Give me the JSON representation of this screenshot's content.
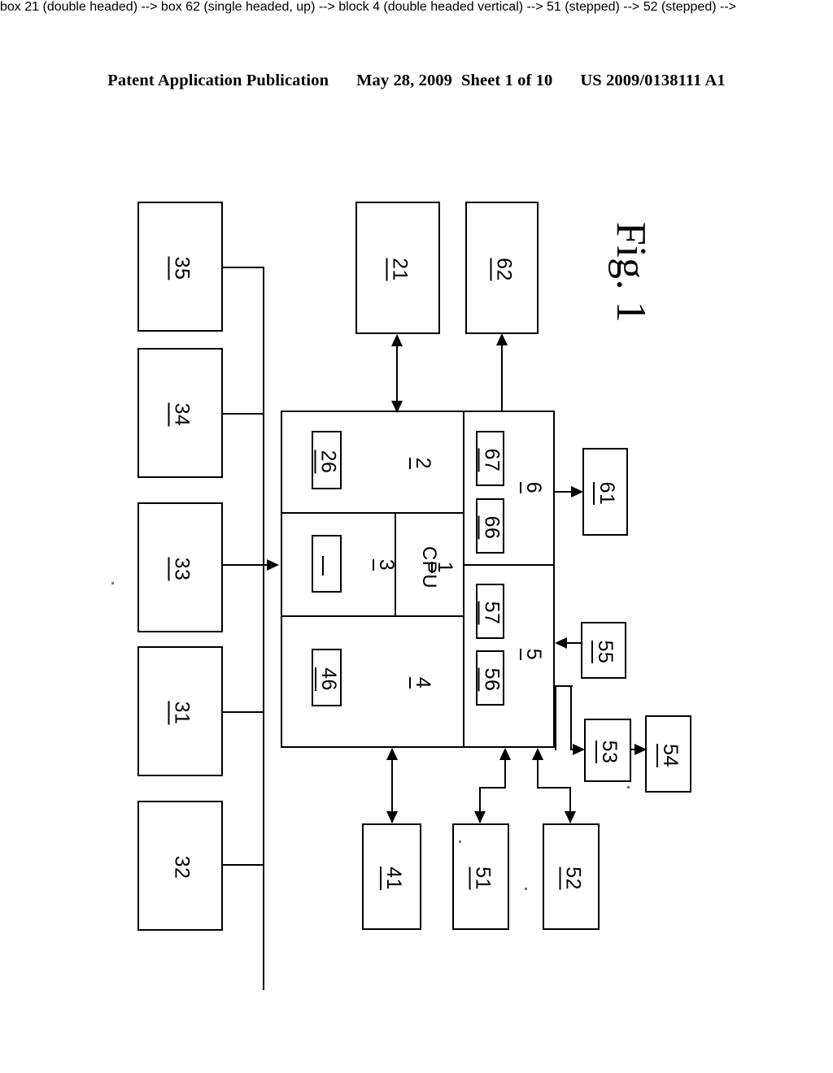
{
  "header": {
    "publication": "Patent Application Publication",
    "date": "May 28, 2009",
    "sheet": "Sheet 1 of 10",
    "docnum": "US 2009/0138111 A1"
  },
  "figure": {
    "caption": "Fig. 1",
    "boxes": {
      "b35": "35",
      "b34": "34",
      "b33": "33",
      "b31": "31",
      "b32": "32",
      "b21": "21",
      "b62": "62",
      "b61": "61",
      "b55": "55",
      "b53": "53",
      "b54": "54",
      "b41": "41",
      "b51": "51",
      "b52": "52",
      "main2": "2",
      "main3": "3",
      "main4": "4",
      "main5": "5",
      "main6": "6",
      "cpu_label": "CPU",
      "cpu_num": "1",
      "b26": "26",
      "b36": "",
      "b46": "46",
      "b66": "66",
      "b67": "67",
      "b56": "56",
      "b57": "57"
    }
  }
}
